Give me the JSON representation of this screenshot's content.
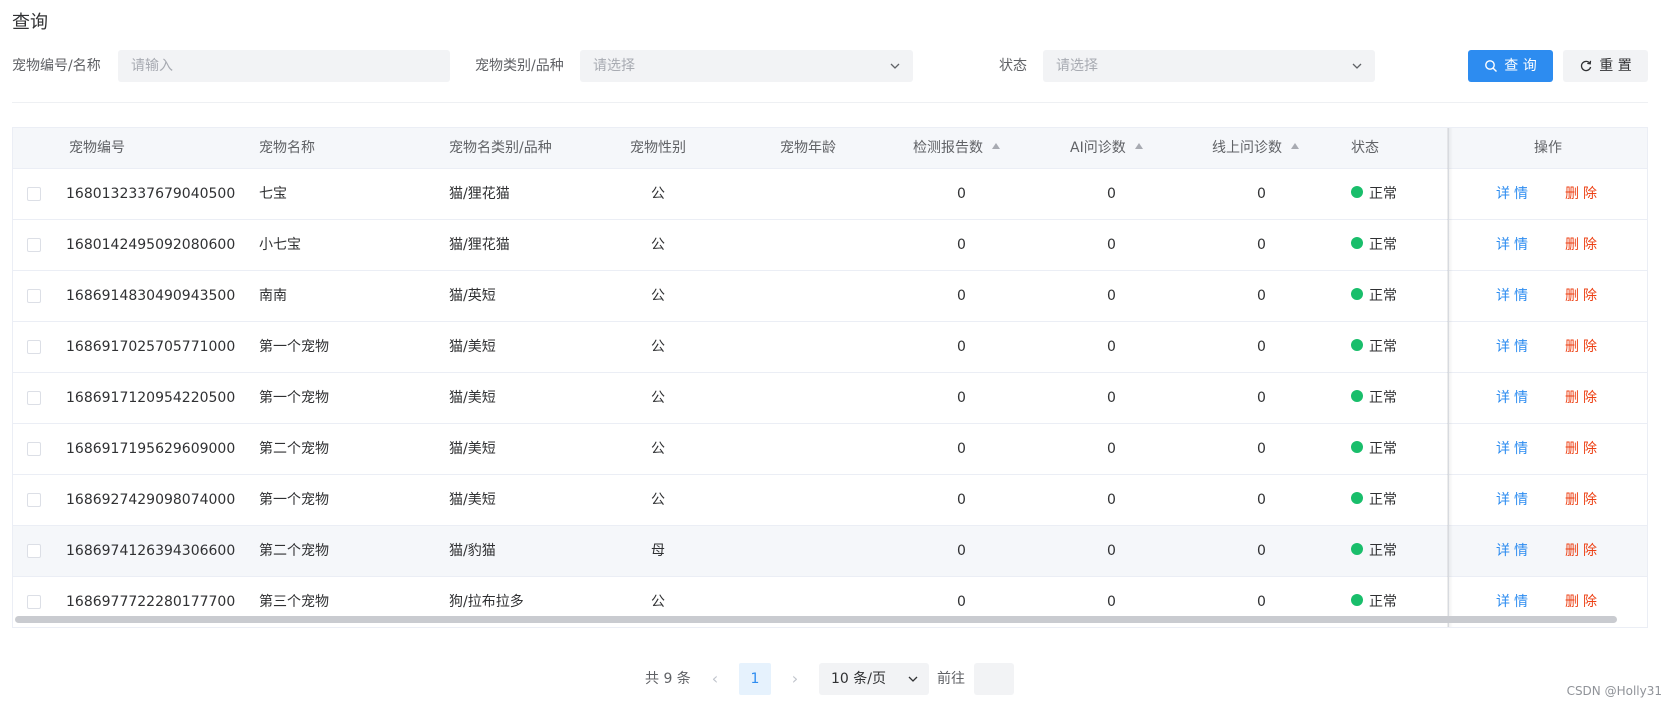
{
  "page": {
    "title": "查询"
  },
  "filters": {
    "pet_id_label": "宠物编号/名称",
    "pet_id_placeholder": "请输入",
    "category_label": "宠物类别/品种",
    "category_placeholder": "请选择",
    "status_label": "状态",
    "status_placeholder": "请选择",
    "search_label": "查 询",
    "reset_label": "重 置"
  },
  "table": {
    "columns": {
      "id": "宠物编号",
      "name": "宠物名称",
      "category": "宠物名类别/品种",
      "gender": "宠物性别",
      "age": "宠物年龄",
      "reports": "检测报告数",
      "ai": "AI问诊数",
      "online": "线上问诊数",
      "status": "状态",
      "actions": "操作"
    },
    "detail_label": "详情",
    "delete_label": "删除",
    "rows": [
      {
        "id": "1680132337679040500",
        "name": "七宝",
        "category": "猫/狸花猫",
        "gender": "公",
        "age": "",
        "reports": "0",
        "ai": "0",
        "online": "0",
        "status": "正常"
      },
      {
        "id": "1680142495092080600",
        "name": "小七宝",
        "category": "猫/狸花猫",
        "gender": "公",
        "age": "",
        "reports": "0",
        "ai": "0",
        "online": "0",
        "status": "正常"
      },
      {
        "id": "1686914830490943500",
        "name": "南南",
        "category": "猫/英短",
        "gender": "公",
        "age": "",
        "reports": "0",
        "ai": "0",
        "online": "0",
        "status": "正常"
      },
      {
        "id": "1686917025705771000",
        "name": "第一个宠物",
        "category": "猫/美短",
        "gender": "公",
        "age": "",
        "reports": "0",
        "ai": "0",
        "online": "0",
        "status": "正常"
      },
      {
        "id": "1686917120954220500",
        "name": "第一个宠物",
        "category": "猫/美短",
        "gender": "公",
        "age": "",
        "reports": "0",
        "ai": "0",
        "online": "0",
        "status": "正常"
      },
      {
        "id": "1686917195629609000",
        "name": "第二个宠物",
        "category": "猫/美短",
        "gender": "公",
        "age": "",
        "reports": "0",
        "ai": "0",
        "online": "0",
        "status": "正常"
      },
      {
        "id": "1686927429098074000",
        "name": "第一个宠物",
        "category": "猫/美短",
        "gender": "公",
        "age": "",
        "reports": "0",
        "ai": "0",
        "online": "0",
        "status": "正常"
      },
      {
        "id": "1686974126394306600",
        "name": "第二个宠物",
        "category": "猫/豹猫",
        "gender": "母",
        "age": "",
        "reports": "0",
        "ai": "0",
        "online": "0",
        "status": "正常"
      },
      {
        "id": "1686977722280177700",
        "name": "第三个宠物",
        "category": "狗/拉布拉多",
        "gender": "公",
        "age": "",
        "reports": "0",
        "ai": "0",
        "online": "0",
        "status": "正常"
      }
    ]
  },
  "pagination": {
    "total": "共 9 条",
    "prev": "‹",
    "current": "1",
    "next": "›",
    "page_size": "10 条/页",
    "goto_label": "前往"
  },
  "watermark": "CSDN @Holly31",
  "colors": {
    "primary": "#2d8cf0",
    "danger": "#ed4014",
    "success": "#19be6b"
  }
}
